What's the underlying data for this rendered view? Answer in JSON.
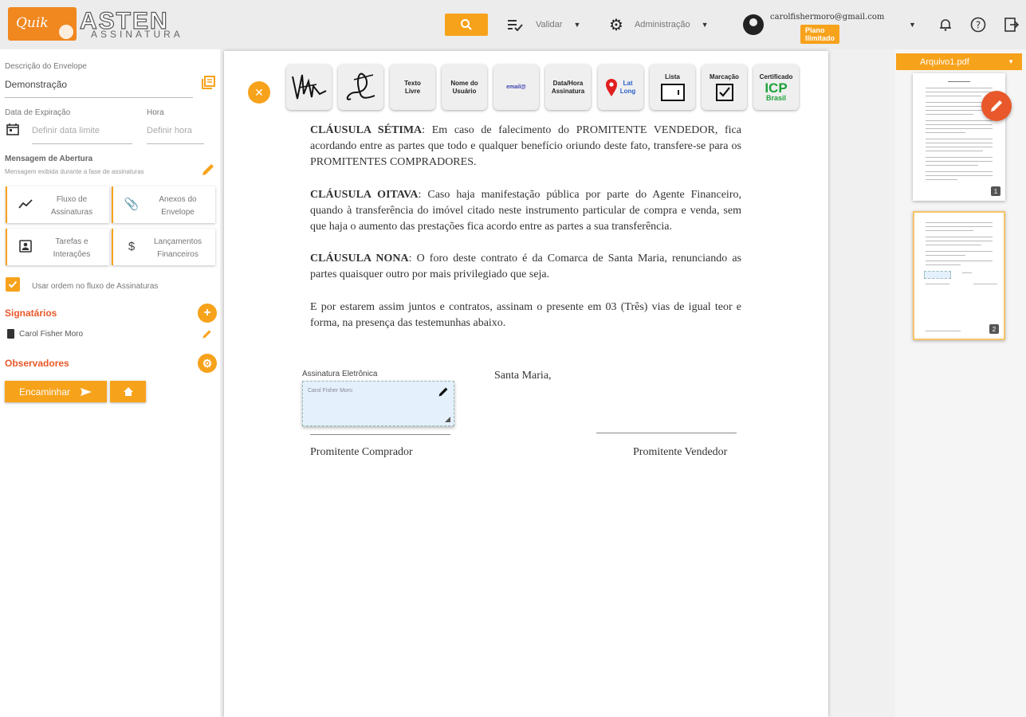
{
  "brand": {
    "name": "ASTEN",
    "subtitle": "ASSINATURA",
    "logo_mark": "Quik"
  },
  "header": {
    "validar": "Validar",
    "admin": "Administração",
    "user_email": "carolfishermoro@gmail.com",
    "plan_badge": "Plano Ilimitado"
  },
  "envelope": {
    "desc_label": "Descrição do Envelope",
    "desc_value": "Demonstração",
    "expiry_label": "Data de Expiração",
    "expiry_placeholder": "Definir data limite",
    "hour_label": "Hora",
    "hour_placeholder": "Definir hora",
    "msg_label": "Mensagem de Abertura",
    "msg_hint": "Mensagem exibida durante a fase de assinaturas"
  },
  "tiles": {
    "flow": "Fluxo de Assinaturas",
    "attachments": "Anexos do Envelope",
    "tasks": "Tarefas e Interações",
    "finance": "Lançamentos Financeiros"
  },
  "order_checkbox": "Usar ordem no fluxo de Assinaturas",
  "signers": {
    "title": "Signatários",
    "items": [
      "Carol Fisher Moro"
    ]
  },
  "observers": {
    "title": "Observadores"
  },
  "forward_button": "Encaminhar",
  "toolbar": {
    "text_free": "Texto Livre",
    "user_name": "Nome do Usuário",
    "email": "email@",
    "date_sig": "Data/Hora Assinatura",
    "latlong": "Lat Long",
    "list": "Lista",
    "mark": "Marcação",
    "cert_title": "Certificado",
    "cert_icp": "ICP",
    "cert_brasil": "Brasil"
  },
  "document": {
    "p1_head": "CLÁUSULA SÉTIMA",
    "p1_body": ": Em caso de falecimento do PROMITENTE VENDEDOR, fica acordando entre as partes que todo e qualquer benefício oriundo deste fato, transfere-se para os PROMITENTES COMPRADORES.",
    "p2_head": "CLÁUSULA OITAVA",
    "p2_body": ": Caso haja manifestação pública por parte do Agente Financeiro, quando à transferência do imóvel citado neste instrumento particular de compra e venda, sem que haja o aumento das prestações fica acordo entre as partes a sua transferência.",
    "p3_head": "CLÁUSULA NONA",
    "p3_body": ": O foro deste contrato é da Comarca de Santa Maria, renunciando as partes quaisquer outro por mais privilegiado que seja.",
    "p4": "E por estarem assim juntos e contratos, assinam o presente em 03 (Três) vias de igual teor e forma, na presença das testemunhas abaixo.",
    "sig_label": "Assinatura Eletrônica",
    "sig_name": "Carol Fisher Moro",
    "city": "Santa Maria,",
    "buyer": "Promitente Comprador",
    "seller": "Promitente Vendedor"
  },
  "files": {
    "selected": "Arquivo1.pdf",
    "pages": [
      "1",
      "2"
    ]
  },
  "colors": {
    "accent": "#f7a21b",
    "danger_title": "#e8582a",
    "edit_fab": "#e8582a"
  }
}
